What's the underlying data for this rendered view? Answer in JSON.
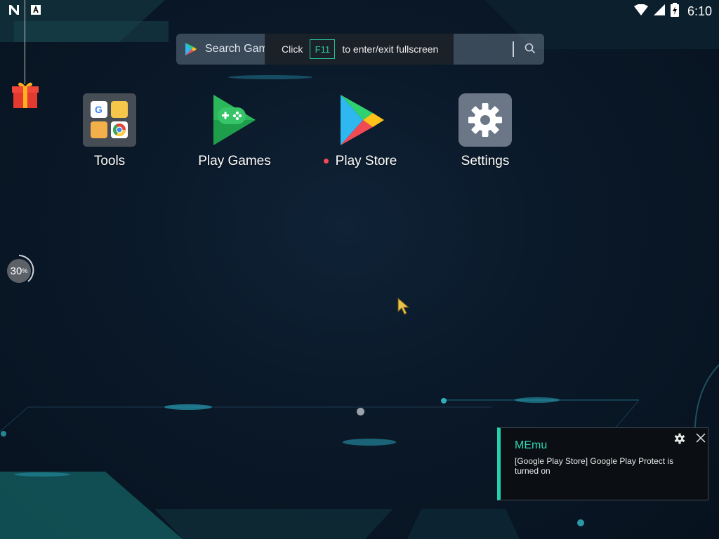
{
  "status_bar": {
    "left_icons": [
      "n-icon",
      "a-icon"
    ],
    "right_icons": [
      "wifi-icon",
      "signal-icon",
      "battery-icon"
    ],
    "clock": "6:10"
  },
  "search": {
    "placeholder": "Search Games and Apps"
  },
  "fullscreen_tip": {
    "prefix": "Click",
    "key": "F11",
    "suffix": "to enter/exit fullscreen"
  },
  "apps": [
    {
      "label": "Tools",
      "icon": "tools-folder-icon"
    },
    {
      "label": "Play Games",
      "icon": "play-games-icon"
    },
    {
      "label": "Play Store",
      "icon": "play-store-icon",
      "new_dot": true
    },
    {
      "label": "Settings",
      "icon": "settings-gear-icon"
    }
  ],
  "progress": {
    "value": "30",
    "unit": "%"
  },
  "notification": {
    "title": "MEmu",
    "body": "[Google Play Store] Google Play Protect is turned on"
  },
  "colors": {
    "accent": "#26d0ac",
    "new_dot": "#f44a55",
    "background": "#0a1828"
  }
}
